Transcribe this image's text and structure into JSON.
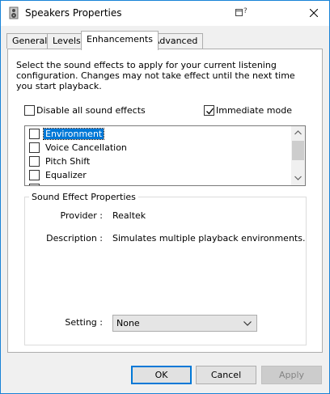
{
  "window": {
    "title": "Speakers Properties",
    "app_icon": "speaker-properties-icon",
    "help_icon": "context-help-icon",
    "close_icon": "close-icon"
  },
  "tabs": [
    {
      "label": "General",
      "active": false
    },
    {
      "label": "Levels",
      "active": false
    },
    {
      "label": "Enhancements",
      "active": true
    },
    {
      "label": "Advanced",
      "active": false
    }
  ],
  "enhancements": {
    "description": "Select the sound effects to apply for your current listening configuration. Changes may not take effect until the next time you start playback.",
    "disable_all": {
      "label": "Disable all sound effects",
      "checked": false
    },
    "immediate_mode": {
      "label": "Immediate mode",
      "checked": true
    },
    "effects": [
      {
        "label": "Environment",
        "checked": false,
        "selected": true
      },
      {
        "label": "Voice Cancellation",
        "checked": false,
        "selected": false
      },
      {
        "label": "Pitch Shift",
        "checked": false,
        "selected": false
      },
      {
        "label": "Equalizer",
        "checked": false,
        "selected": false
      }
    ],
    "properties": {
      "title": "Sound Effect Properties",
      "provider_label": "Provider :",
      "provider_value": "Realtek",
      "description_label": "Description :",
      "description_value": "Simulates multiple playback environments.",
      "setting_label": "Setting :",
      "setting_value": "None"
    }
  },
  "buttons": {
    "ok": "OK",
    "cancel": "Cancel",
    "apply": "Apply"
  },
  "colors": {
    "accent": "#0078d7",
    "window_border": "#1883d7",
    "disabled_text": "#838383"
  }
}
